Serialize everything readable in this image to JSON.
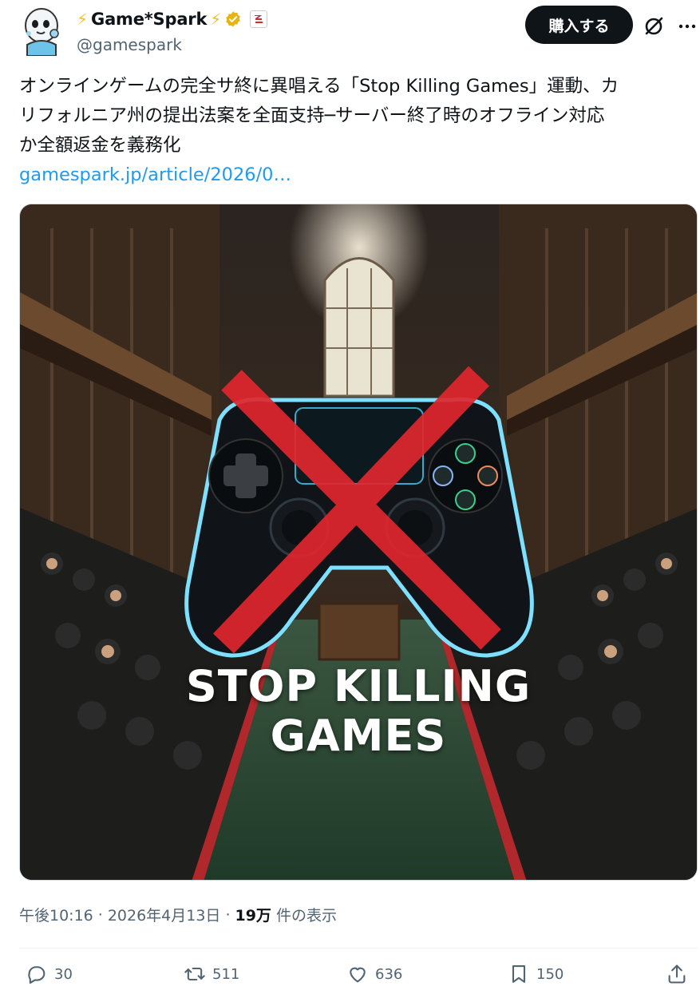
{
  "account": {
    "display_name": "Game*Spark",
    "bolt_left": "⚡",
    "bolt_right": "⚡",
    "handle": "@gamespark",
    "brand_badge": "ℨ"
  },
  "buttons": {
    "buy_label": "購入する"
  },
  "tweet": {
    "lines": [
      "オンラインゲームの完全サ終に異唱える「Stop Killing Games」運動、カ",
      "リフォルニア州の提出法案を全面支持─サーバー終了時のオフライン対応",
      "か全額返金を義務化"
    ],
    "link": "gamespark.jp/article/2026/0…"
  },
  "media": {
    "overlay_line1": "STOP KILLING",
    "overlay_line2": "GAMES"
  },
  "meta": {
    "time": "午後10:16",
    "sep1": "·",
    "date": "2026年4月13日",
    "sep2": "·",
    "views_count": "19万",
    "views_label": "件の表示"
  },
  "actions": {
    "replies": "30",
    "reposts": "511",
    "likes": "636",
    "bookmarks": "150"
  },
  "icons": {
    "bolt": "lightning-icon",
    "verified": "verified-badge-icon",
    "grok": "grok-icon",
    "more": "more-options-icon",
    "reply": "reply-icon",
    "repost": "repost-icon",
    "like": "heart-icon",
    "bookmark": "bookmark-icon",
    "share": "share-icon"
  },
  "colors": {
    "link": "#1d9bf0",
    "muted": "#536471",
    "verified": "#e8b30f",
    "button_bg": "#0f1419"
  }
}
